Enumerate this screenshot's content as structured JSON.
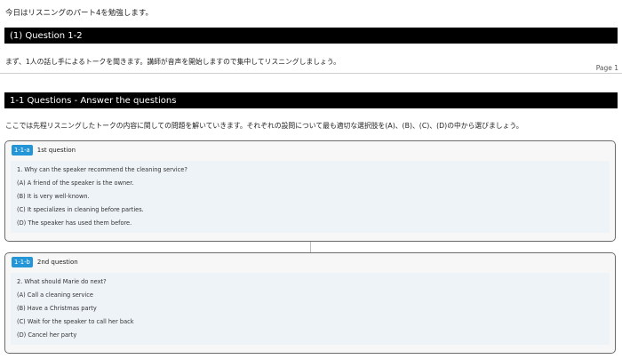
{
  "intro": "今日はリスニングのパート4を勉強します。",
  "section1": {
    "title": "(1) Question 1-2",
    "description": "まず、1人の話し手によるトークを聞きます。講師が音声を開始しますので集中してリスニングしましょう。",
    "page_label": "Page 1"
  },
  "section2": {
    "title": "1-1 Questions - Answer the questions",
    "description": "ここでは先程リスニングしたトークの内容に関しての問題を解いていきます。それぞれの設問について最も適切な選択肢を(A)、(B)、(C)、(D)の中から選びましょう。"
  },
  "questions": [
    {
      "badge": "1-1-a",
      "title": "1st question",
      "text": "1. Why can the speaker recommend the cleaning service?",
      "options": [
        "(A) A friend of the speaker is the owner.",
        "(B) It is very well-known.",
        "(C) It specializes in cleaning before parties.",
        "(D) The speaker has used them before."
      ]
    },
    {
      "badge": "1-1-b",
      "title": "2nd question",
      "text": "2. What should Marie do next?",
      "options": [
        "(A) Call a cleaning service",
        "(B) Have a Christmas party",
        "(C) Wait for the speaker to call her back",
        "(D) Cancel her party"
      ]
    }
  ],
  "colors": {
    "badge": "#2496d8",
    "section_bar": "#000000",
    "box_border": "#6b6b6b"
  }
}
